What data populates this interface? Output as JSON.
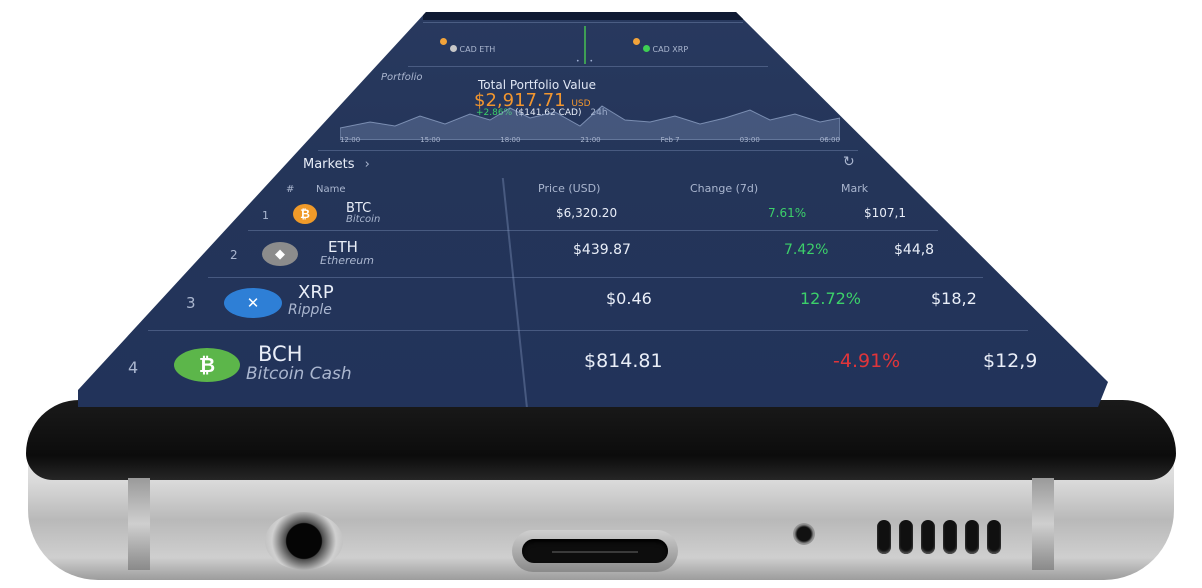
{
  "ticker": {
    "items": [
      {
        "symbol": "",
        "color": "#f2a33a"
      },
      {
        "symbol": "",
        "color": "#f2a33a"
      },
      {
        "symbol": "CAD ETH",
        "color": "#c7c7c7"
      },
      {
        "symbol": "CAD XRP",
        "color": "#3ecf53"
      }
    ]
  },
  "portfolio": {
    "section_label": "Portfolio",
    "title": "Total Portfolio Value",
    "value": "$2,917.71",
    "currency": "USD",
    "change": "+2.86%",
    "sub_value": "($141.62 CAD)",
    "period": "24h",
    "time_labels": [
      "12:00",
      "15:00",
      "18:00",
      "21:00",
      "Feb 7",
      "03:00",
      "06:00"
    ]
  },
  "markets": {
    "title": "Markets",
    "columns": {
      "rank": "#",
      "name": "Name",
      "price": "Price (USD)",
      "change": "Change (7d)",
      "market": "Mark"
    },
    "rows": [
      {
        "rank": "1",
        "symbol": "BTC",
        "name": "Bitcoin",
        "price": "$6,320.20",
        "change": "7.61%",
        "market": "$107,1",
        "up": true,
        "icon_color": "#f09a29",
        "glyph": "₿"
      },
      {
        "rank": "2",
        "symbol": "ETH",
        "name": "Ethereum",
        "price": "$439.87",
        "change": "7.42%",
        "market": "$44,8",
        "up": true,
        "icon_color": "#8c8c8c",
        "glyph": "◆"
      },
      {
        "rank": "3",
        "symbol": "XRP",
        "name": "Ripple",
        "price": "$0.46",
        "change": "12.72%",
        "market": "$18,2",
        "up": true,
        "icon_color": "#2e7fd6",
        "glyph": "✕"
      },
      {
        "rank": "4",
        "symbol": "BCH",
        "name": "Bitcoin Cash",
        "price": "$814.81",
        "change": "-4.91%",
        "market": "$12,9",
        "up": false,
        "icon_color": "#5cb64a",
        "glyph": "₿"
      }
    ]
  },
  "colors": {
    "up": "#3cd06a",
    "down": "#e0353a",
    "accent": "#f2962f"
  }
}
